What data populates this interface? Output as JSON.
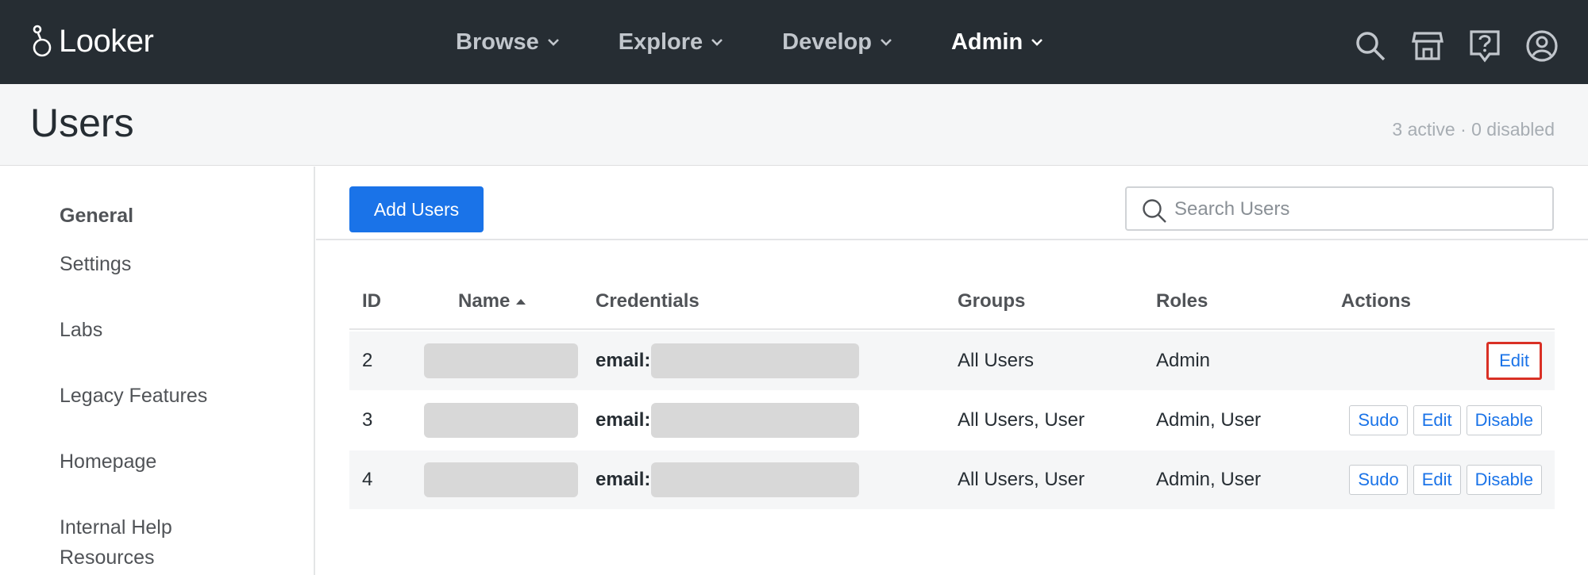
{
  "app": {
    "name": "Looker"
  },
  "nav": [
    {
      "label": "Browse",
      "active": false
    },
    {
      "label": "Explore",
      "active": false
    },
    {
      "label": "Develop",
      "active": false
    },
    {
      "label": "Admin",
      "active": true
    }
  ],
  "top_icons": [
    "search-icon",
    "marketplace-icon",
    "help-icon",
    "account-icon"
  ],
  "page": {
    "title": "Users",
    "counts": "3 active · 0 disabled"
  },
  "sidebar": {
    "heading": "General",
    "items": [
      "Settings",
      "Labs",
      "Legacy Features",
      "Homepage",
      "Internal Help",
      "Resources"
    ]
  },
  "toolbar": {
    "add_label": "Add Users",
    "search_placeholder": "Search Users"
  },
  "table": {
    "headers": {
      "id": "ID",
      "name": "Name",
      "credentials": "Credentials",
      "groups": "Groups",
      "roles": "Roles",
      "actions": "Actions"
    },
    "credential_prefix": "email:",
    "rows": [
      {
        "id": "2",
        "groups": "All Users",
        "roles": "Admin",
        "actions": [
          "Edit"
        ]
      },
      {
        "id": "3",
        "groups": "All Users, User",
        "roles": "Admin, User",
        "actions": [
          "Sudo",
          "Edit",
          "Disable"
        ]
      },
      {
        "id": "4",
        "groups": "All Users, User",
        "roles": "Admin, User",
        "actions": [
          "Sudo",
          "Edit",
          "Disable"
        ]
      }
    ]
  },
  "colors": {
    "topbar": "#262d33",
    "primary": "#1a73e8",
    "highlight": "#d93025"
  }
}
